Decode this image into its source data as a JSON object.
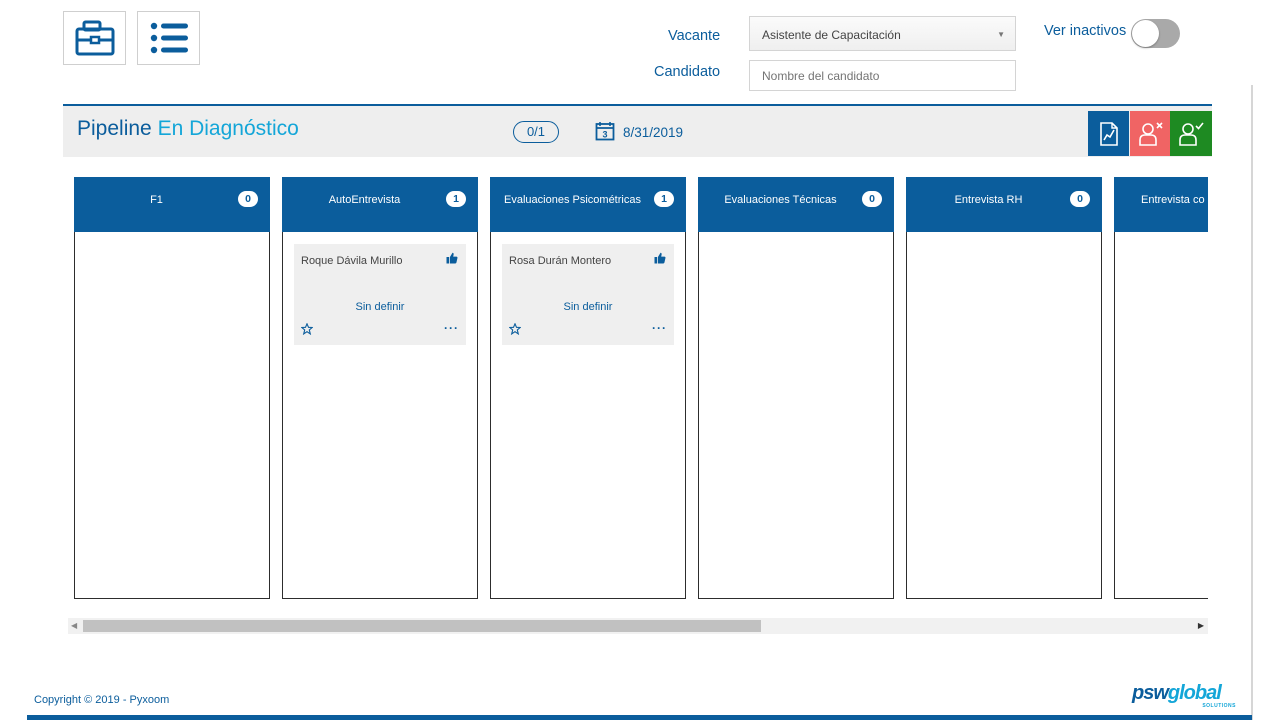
{
  "toolbar": {
    "vacancies_icon": "briefcase-icon",
    "list_icon": "list-icon"
  },
  "filters": {
    "vacancy_label": "Vacante",
    "vacancy_value": "Asistente de Capacitación",
    "candidate_label": "Candidato",
    "candidate_placeholder": "Nombre del candidato",
    "inactive_label": "Ver inactivos",
    "inactive_on": false
  },
  "pipeline": {
    "title_prefix": "Pipeline",
    "stage_name": "En Diagnóstico",
    "counter": "0/1",
    "date": "8/31/2019",
    "actions": [
      {
        "name": "report",
        "icon": "report-chart-icon",
        "color": "#0b5d9c"
      },
      {
        "name": "reject",
        "icon": "user-reject-icon",
        "color": "#f06464"
      },
      {
        "name": "accept",
        "icon": "user-accept-icon",
        "color": "#1e8a22"
      }
    ]
  },
  "columns": [
    {
      "title": "F1",
      "count": "0",
      "cards": []
    },
    {
      "title": "AutoEntrevista",
      "count": "1",
      "cards": [
        {
          "name": "Roque Dávila Murillo",
          "status": "Sin definir"
        }
      ]
    },
    {
      "title": "Evaluaciones Psicométricas",
      "count": "1",
      "cards": [
        {
          "name": "Rosa Durán Montero",
          "status": "Sin definir"
        }
      ]
    },
    {
      "title": "Evaluaciones Técnicas",
      "count": "0",
      "cards": []
    },
    {
      "title": "Entrevista RH",
      "count": "0",
      "cards": []
    },
    {
      "title": "Entrevista co",
      "count": "",
      "cards": []
    }
  ],
  "colors": {
    "primary": "#0b5d9c",
    "accent": "#14a6d8",
    "danger": "#f06464",
    "success": "#1e8a22"
  },
  "footer": {
    "copyright": "Copyright © 2019 - Pyxoom",
    "brand_psw": "psw",
    "brand_global": "global",
    "brand_sub": "SOLUTIONS"
  }
}
